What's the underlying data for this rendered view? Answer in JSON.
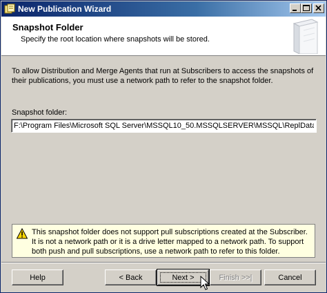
{
  "window": {
    "title": "New Publication Wizard"
  },
  "header": {
    "title": "Snapshot Folder",
    "subtitle": "Specify the root location where snapshots will be stored."
  },
  "body": {
    "intro": "To allow Distribution and Merge Agents that run at Subscribers to access the snapshots of their publications, you must use a network path to refer to the snapshot folder.",
    "folder_label": "Snapshot folder:",
    "folder_value": "F:\\Program Files\\Microsoft SQL Server\\MSSQL10_50.MSSQLSERVER\\MSSQL\\ReplData"
  },
  "warning": {
    "icon": "warning-triangle-icon",
    "text": "This snapshot folder does not support pull subscriptions created at the Subscriber. It is not a network path or it is a drive letter mapped to a network path. To support both push and pull subscriptions, use a network path to refer to this folder."
  },
  "buttons": {
    "help": "Help",
    "back": "< Back",
    "next": "Next >",
    "finish": "Finish >>|",
    "cancel": "Cancel"
  },
  "colors": {
    "titlebar_start": "#0a246a",
    "titlebar_end": "#a6caf0",
    "dialog_face": "#d4d0c8",
    "warning_background": "#ffffe1"
  }
}
